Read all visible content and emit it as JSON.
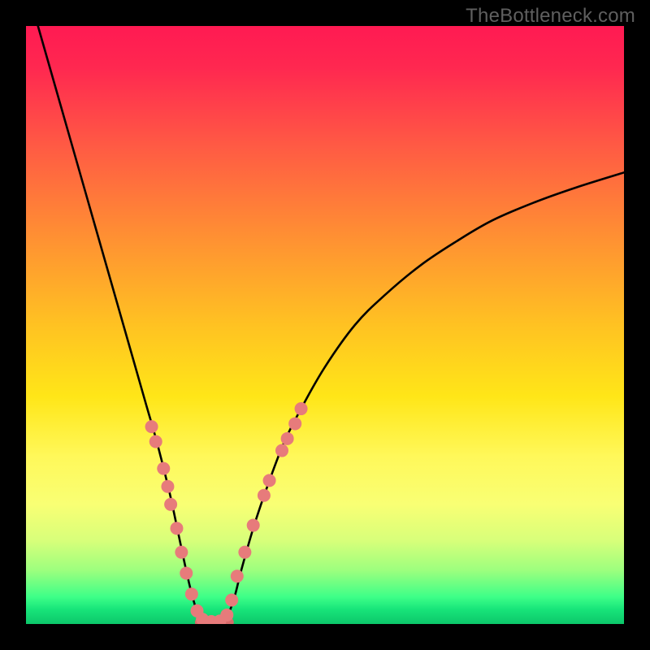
{
  "watermark": {
    "text": "TheBottleneck.com"
  },
  "chart_data": {
    "type": "line",
    "title": "",
    "xlabel": "",
    "ylabel": "",
    "xlim": [
      0,
      100
    ],
    "ylim": [
      0,
      100
    ],
    "gradient_stops": [
      {
        "offset": 0,
        "color": "#ff1a52"
      },
      {
        "offset": 0.07,
        "color": "#ff2850"
      },
      {
        "offset": 0.2,
        "color": "#ff5a44"
      },
      {
        "offset": 0.35,
        "color": "#ff8f33"
      },
      {
        "offset": 0.5,
        "color": "#ffc222"
      },
      {
        "offset": 0.62,
        "color": "#ffe618"
      },
      {
        "offset": 0.72,
        "color": "#fff85a"
      },
      {
        "offset": 0.8,
        "color": "#f9ff74"
      },
      {
        "offset": 0.86,
        "color": "#d8ff7a"
      },
      {
        "offset": 0.91,
        "color": "#9dff7e"
      },
      {
        "offset": 0.955,
        "color": "#3dff88"
      },
      {
        "offset": 0.975,
        "color": "#18e57a"
      },
      {
        "offset": 1.0,
        "color": "#0cc76a"
      }
    ],
    "series": [
      {
        "name": "bottleneck_curve_left",
        "x": [
          2,
          4,
          6,
          8,
          10,
          12,
          14,
          16,
          18,
          20,
          22,
          24,
          25.5,
          27,
          28,
          29,
          30
        ],
        "y": [
          100,
          93,
          86,
          79,
          72,
          65,
          58,
          51,
          44,
          37,
          30,
          22,
          15,
          8,
          4,
          1,
          0
        ]
      },
      {
        "name": "bottleneck_curve_right",
        "x": [
          33,
          34,
          35,
          36,
          38,
          40,
          43,
          46,
          50,
          55,
          60,
          66,
          72,
          78,
          85,
          92,
          100
        ],
        "y": [
          0,
          2,
          5,
          9,
          16,
          22,
          30,
          36,
          43,
          50,
          55,
          60,
          64,
          67.5,
          70.5,
          73,
          75.5
        ]
      },
      {
        "name": "flat_bottom",
        "x": [
          29,
          30,
          31,
          32,
          33,
          34
        ],
        "y": [
          0.3,
          0.1,
          0.05,
          0.05,
          0.1,
          0.3
        ]
      }
    ],
    "dots": {
      "name": "plotted_points",
      "color": "#e77b7b",
      "radius": 8,
      "points": [
        {
          "x": 21.0,
          "y": 33.0
        },
        {
          "x": 21.7,
          "y": 30.5
        },
        {
          "x": 23.0,
          "y": 26.0
        },
        {
          "x": 23.7,
          "y": 23.0
        },
        {
          "x": 24.2,
          "y": 20.0
        },
        {
          "x": 25.2,
          "y": 16.0
        },
        {
          "x": 26.0,
          "y": 12.0
        },
        {
          "x": 26.8,
          "y": 8.5
        },
        {
          "x": 27.7,
          "y": 5.0
        },
        {
          "x": 28.6,
          "y": 2.2
        },
        {
          "x": 29.5,
          "y": 0.8
        },
        {
          "x": 31.0,
          "y": 0.4
        },
        {
          "x": 32.4,
          "y": 0.5
        },
        {
          "x": 33.6,
          "y": 1.5
        },
        {
          "x": 34.4,
          "y": 4.0
        },
        {
          "x": 35.3,
          "y": 8.0
        },
        {
          "x": 36.6,
          "y": 12.0
        },
        {
          "x": 38.0,
          "y": 16.5
        },
        {
          "x": 39.8,
          "y": 21.5
        },
        {
          "x": 40.7,
          "y": 24.0
        },
        {
          "x": 42.8,
          "y": 29.0
        },
        {
          "x": 43.7,
          "y": 31.0
        },
        {
          "x": 45.0,
          "y": 33.5
        },
        {
          "x": 46.0,
          "y": 36.0
        }
      ]
    }
  }
}
